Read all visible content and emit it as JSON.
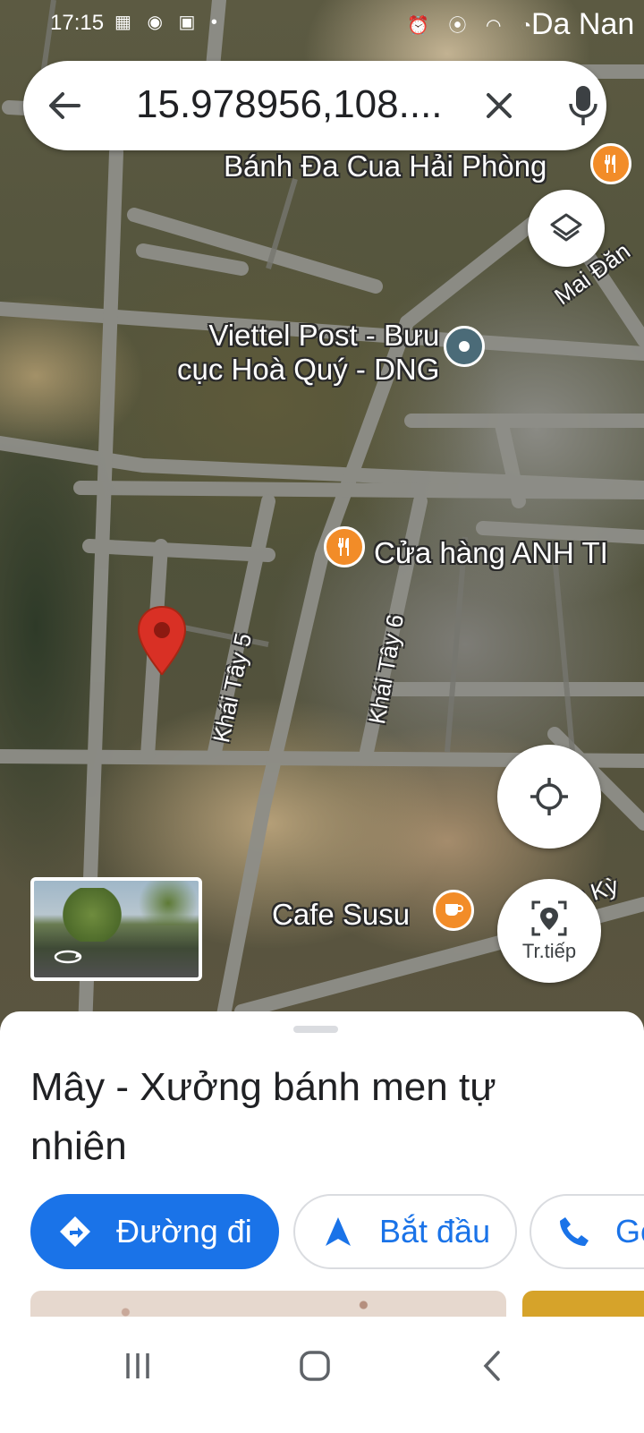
{
  "status_bar": {
    "time": "17:15",
    "location_fragment": "Da Nan"
  },
  "search": {
    "query": "15.978956,108...."
  },
  "map": {
    "labels": {
      "banh_da": "Bánh Đa Cua Hải Phòng",
      "viettel": "Viettel Post - Bưu\ncục Hoà Quý - DNG",
      "cua_hang": "Cửa hàng ANH TI",
      "cafe": "Cafe Susu",
      "mai_dang": "Mai Đăn",
      "ky": "n Kỳ"
    },
    "streets": {
      "khai_tay_5": "Khái Tây 5",
      "khai_tay_6": "Khái Tây 6"
    },
    "live_view_label": "Tr.tiếp",
    "colors": {
      "poi_food": "#f28c28",
      "poi_service": "#4b6b78",
      "pin": "#d93025"
    }
  },
  "place": {
    "name": "Mây - Xưởng bánh men tự nhiên"
  },
  "actions": {
    "directions_label": "Đường đi",
    "start_label": "Bắt đầu",
    "call_label": "Gọi"
  },
  "accent_color": "#1a73e8"
}
